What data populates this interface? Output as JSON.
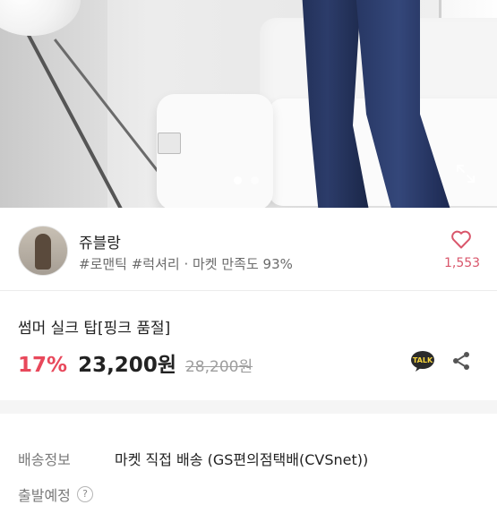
{
  "gallery": {
    "total_images": 2,
    "current_image": 1
  },
  "seller": {
    "name": "쥬블랑",
    "tags": "#로맨틱 #럭셔리 · 마켓 만족도 93%",
    "like_count": "1,553"
  },
  "product": {
    "title": "썸머 실크 탑[핑크 품절]",
    "discount": "17%",
    "price": "23,200원",
    "original_price": "28,200원"
  },
  "actions": {
    "talk_label": "TALK"
  },
  "shipping": {
    "label": "배송정보",
    "value": "마켓 직접 배송 (GS편의점택배(CVSnet))",
    "depart_label": "출발예정",
    "help_icon": "?"
  },
  "colors": {
    "accent": "#e8485b",
    "like": "#d9566b",
    "talk_bg": "#2b2b2b",
    "talk_fg": "#f7d63e"
  },
  "icons": [
    "expand-icon",
    "heart-icon",
    "talk-icon",
    "share-icon",
    "help-icon"
  ]
}
